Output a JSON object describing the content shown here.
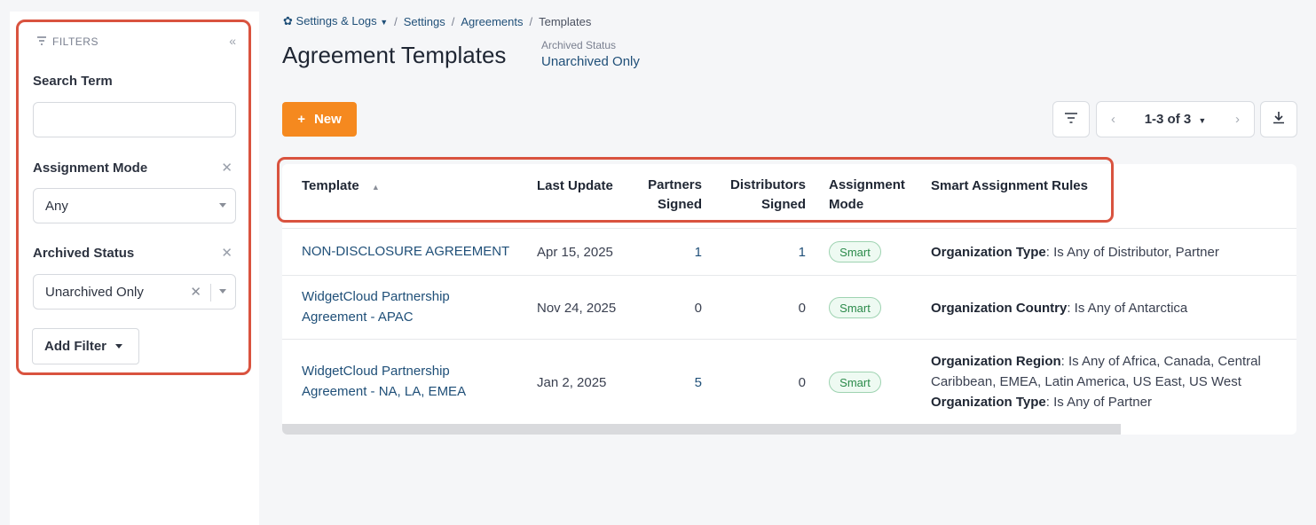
{
  "sidebar": {
    "filters_title": "FILTERS",
    "search_label": "Search Term",
    "search_value": "",
    "assignment_mode_label": "Assignment Mode",
    "assignment_mode_value": "Any",
    "archived_status_label": "Archived Status",
    "archived_status_value": "Unarchived Only",
    "add_filter_label": "Add Filter"
  },
  "breadcrumb": {
    "root": "Settings & Logs",
    "items": [
      "Settings",
      "Agreements"
    ],
    "current": "Templates"
  },
  "header": {
    "title": "Agreement Templates",
    "archived_label": "Archived Status",
    "archived_value": "Unarchived Only"
  },
  "toolbar": {
    "new_label": "New",
    "pager_label": "1-3 of 3"
  },
  "table": {
    "columns": {
      "template": "Template",
      "last_update": "Last Update",
      "partners_signed_1": "Partners",
      "partners_signed_2": "Signed",
      "distributors_signed_1": "Distributors",
      "distributors_signed_2": "Signed",
      "assignment_mode_1": "Assignment",
      "assignment_mode_2": "Mode",
      "rules": "Smart Assignment Rules"
    },
    "rows": [
      {
        "template_1": "NON-DISCLOSURE AGREEMENT",
        "template_2": "",
        "last_update": "Apr 15, 2025",
        "partners": "1",
        "distributors": "1",
        "mode": "Smart",
        "rule1_key": "Organization Type",
        "rule1_val": ": Is Any of Distributor, Partner"
      },
      {
        "template_1": "WidgetCloud Partnership",
        "template_2": "Agreement - APAC",
        "last_update": "Nov 24, 2025",
        "partners": "0",
        "distributors": "0",
        "mode": "Smart",
        "rule1_key": "Organization Country",
        "rule1_val": ": Is Any of Antarctica"
      },
      {
        "template_1": "WidgetCloud Partnership",
        "template_2": "Agreement - NA, LA, EMEA",
        "last_update": "Jan 2, 2025",
        "partners": "5",
        "distributors": "0",
        "mode": "Smart",
        "rule1_key": "Organization Region",
        "rule1_val": ": Is Any of Africa, Canada, Central",
        "rule1_cont": "Caribbean, EMEA, Latin America, US East, US West",
        "rule2_key": "Organization Type",
        "rule2_val": ": Is Any of Partner"
      }
    ]
  },
  "colors": {
    "accent_orange": "#f5891f",
    "link_blue": "#1f4f78",
    "highlight_red": "#d9533f",
    "badge_green": "#2a8a4a"
  }
}
